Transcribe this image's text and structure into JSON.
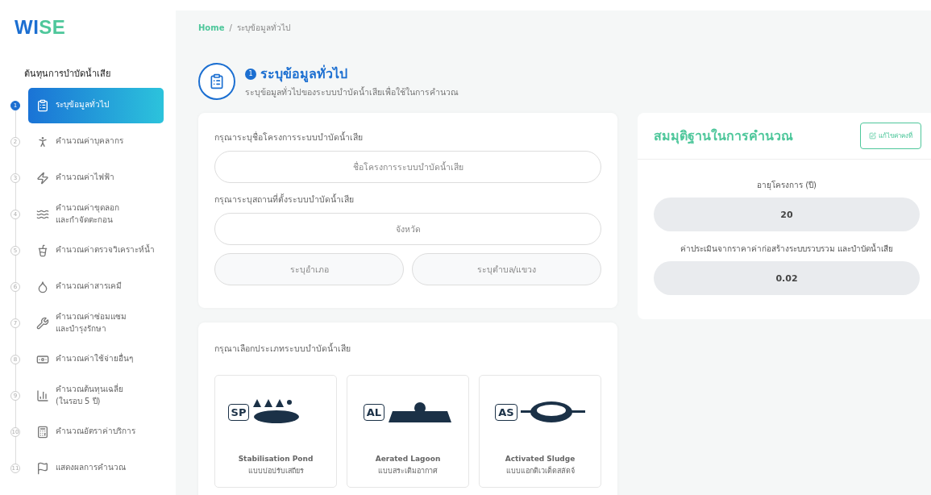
{
  "logo": {
    "first": "WI",
    "second": "SE"
  },
  "sidebar": {
    "heading": "ต้นทุนการบำบัดน้ำเสีย",
    "items": [
      {
        "step": "1",
        "label": "ระบุข้อมูลทั่วไป",
        "selected": true
      },
      {
        "step": "2",
        "label": "คำนวณค่าบุคลากร",
        "selected": false
      },
      {
        "step": "3",
        "label": "คำนวณค่าไฟฟ้า",
        "selected": false
      },
      {
        "step": "4",
        "label": "คำนวณค่าขุดลอก\nและกำจัดตะกอน",
        "selected": false
      },
      {
        "step": "5",
        "label": "คำนวณค่าตรวจวิเคราะห์น้ำ",
        "selected": false
      },
      {
        "step": "6",
        "label": "คำนวณค่าสารเคมี",
        "selected": false
      },
      {
        "step": "7",
        "label": "คำนวณค่าซ่อมแซม\nและบำรุงรักษา",
        "selected": false
      },
      {
        "step": "8",
        "label": "คำนวณค่าใช้จ่ายอื่นๆ",
        "selected": false
      },
      {
        "step": "9",
        "label": "คำนวณต้นทุนเฉลี่ย\n(ในรอบ 5 ปี)",
        "selected": false
      },
      {
        "step": "10",
        "label": "คำนวณอัตราค่าบริการ",
        "selected": false
      },
      {
        "step": "11",
        "label": "แสดงผลการคำนวณ",
        "selected": false
      }
    ]
  },
  "breadcrumb_separator": "/",
  "breadcrumb": [
    {
      "label": "Home",
      "kind": "link"
    },
    {
      "label": "ระบุข้อมูลทั่วไป",
      "kind": "current"
    }
  ],
  "header": {
    "step": "1",
    "title": "ระบุข้อมูลทั่วไป",
    "subtitle": "ระบุข้อมูลทั่วไปของระบบบำบัดน้ำเสียเพื่อใช้ในการคำนวณ"
  },
  "form": {
    "name_label": "กรุณาระบุชื่อโครงการระบบบำบัดน้ำเสีย",
    "name_placeholder": "ชื่อโครงการระบบบำบัดน้ำเสีย",
    "location_label": "กรุณาระบุสถานที่ตั้งระบบบำบัดน้ำเสีย",
    "province_placeholder": "จังหวัด",
    "district_placeholder": "ระบุอำเภอ",
    "subdistrict_placeholder": "ระบุตำบล/แขวง"
  },
  "system_type": {
    "label": "กรุณาเลือกประเภทระบบบำบัดน้ำเสีย",
    "options": [
      {
        "code": "SP",
        "kind": "pond",
        "name": "Stabilisation Pond",
        "thai": "แบบบ่อปรับเสถียร",
        "selected": false
      },
      {
        "code": "AL",
        "kind": "lagoon",
        "name": "Aerated Lagoon",
        "thai": "แบบสระเติมอากาศ",
        "selected": false
      },
      {
        "code": "AS",
        "kind": "sludge",
        "name": "Activated Sludge",
        "thai": "แบบแอกติเวเต็ดสลัดจ์",
        "selected": false
      }
    ]
  },
  "assumptions": {
    "title": "สมมุติฐานในการคำนวณ",
    "edit_button": "แก้ไขค่าคงที่",
    "fields": [
      {
        "label": "อายุโครงการ (ปี)",
        "value": "20"
      },
      {
        "label": "ค่าประเมินจากราคาค่าก่อสร้างระบบรวบรวม และบำบัดน้ำเสีย",
        "value": "0.02"
      }
    ]
  }
}
